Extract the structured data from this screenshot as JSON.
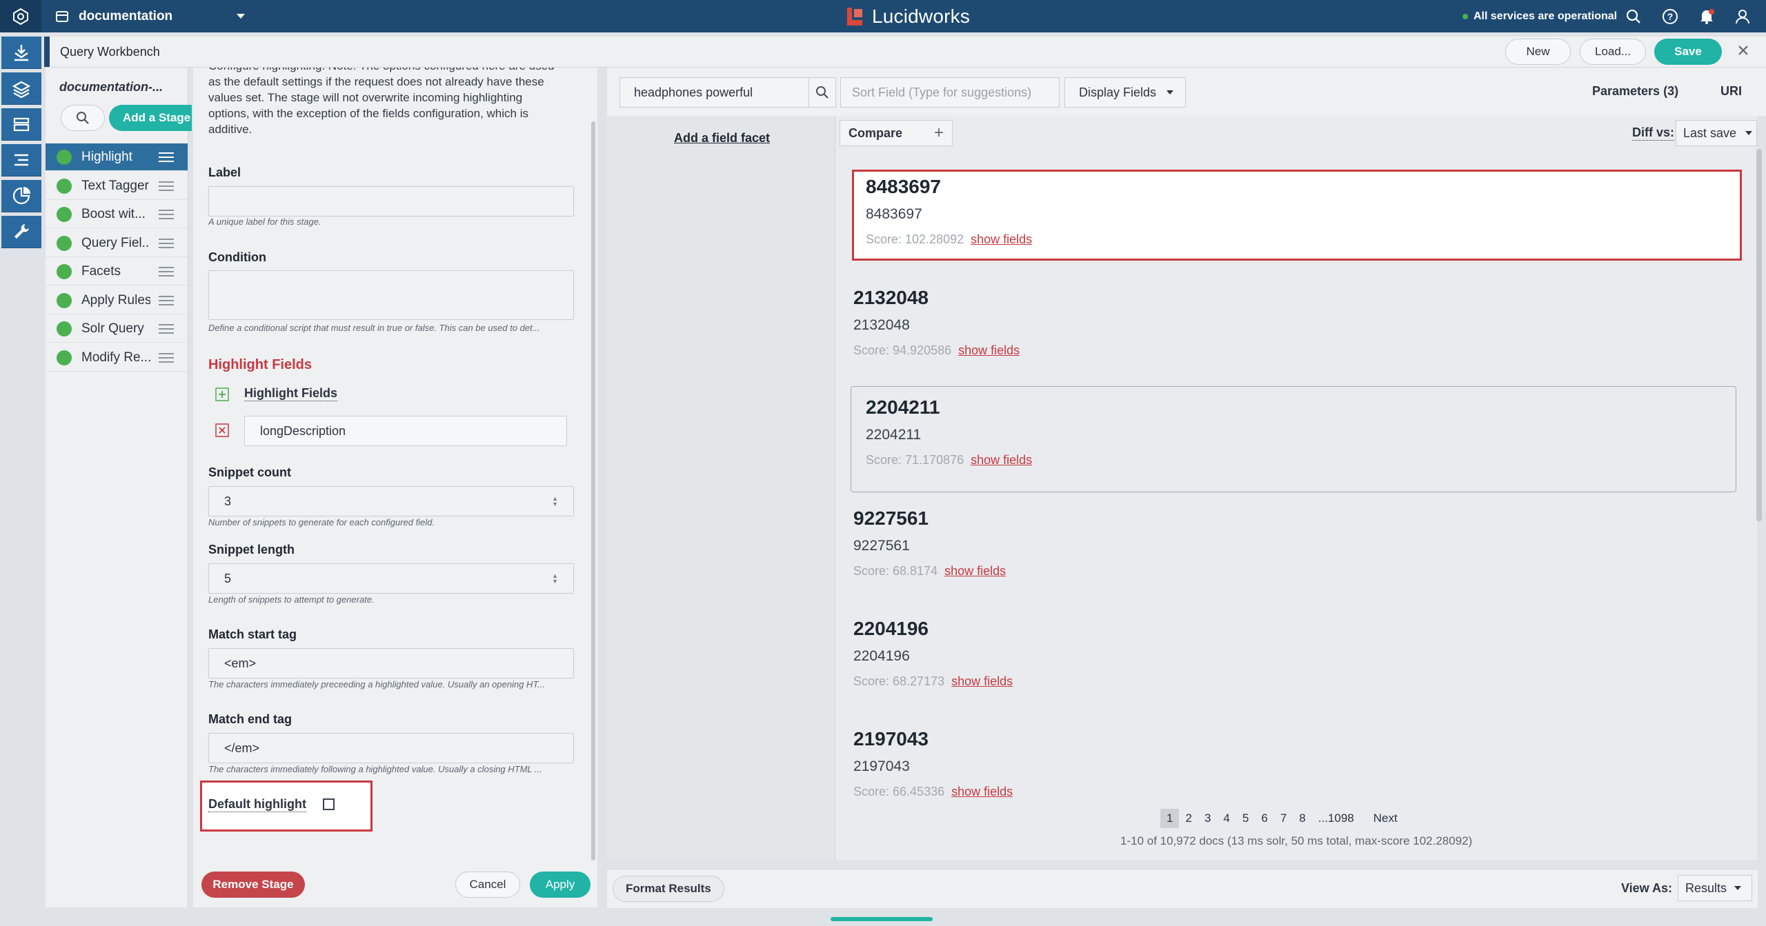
{
  "topbar": {
    "app_name": "documentation",
    "brand": "Lucidworks",
    "status": "All services are operational",
    "icons": [
      "search-icon",
      "help-icon",
      "notification-bell-icon",
      "user-icon"
    ]
  },
  "workbench": {
    "title": "Query Workbench",
    "new_label": "New",
    "load_label": "Load...",
    "save_label": "Save"
  },
  "stages": {
    "pipeline_name": "documentation-...",
    "add_stage_label": "Add a Stage",
    "items": [
      {
        "label": "Highlight"
      },
      {
        "label": "Text Tagger"
      },
      {
        "label": "Boost wit..."
      },
      {
        "label": "Query Fiel..."
      },
      {
        "label": "Facets"
      },
      {
        "label": "Apply Rules"
      },
      {
        "label": "Solr Query"
      },
      {
        "label": "Modify Re..."
      }
    ]
  },
  "config": {
    "intro": "Configure highlighting. Note: The options configured here are used as the default settings if the request does not already have these values set. The stage will not overwrite incoming highlighting options, with the exception of the fields configuration, which is additive.",
    "label": {
      "title": "Label",
      "value": "",
      "help": "A unique label for this stage."
    },
    "condition": {
      "title": "Condition",
      "value": "",
      "help": "Define a conditional script that must result in true or false. This can be used to det..."
    },
    "highlight_fields_section": "Highlight Fields",
    "highlight_fields_add": "Highlight Fields",
    "highlight_field_value": "longDescription",
    "snippet_count": {
      "title": "Snippet count",
      "value": "3",
      "help": "Number of snippets to generate for each configured field."
    },
    "snippet_length": {
      "title": "Snippet length",
      "value": "5",
      "help": "Length of snippets to attempt to generate."
    },
    "match_start": {
      "title": "Match start tag",
      "value": "<em>",
      "help": "The characters immediately preceeding a highlighted value. Usually an opening HT..."
    },
    "match_end": {
      "title": "Match end tag",
      "value": "</em>",
      "help": "The characters immediately following a highlighted value. Usually a closing HTML ..."
    },
    "default_highlight": {
      "title": "Default highlight",
      "checked": false
    },
    "remove_label": "Remove Stage",
    "cancel_label": "Cancel",
    "apply_label": "Apply"
  },
  "query": {
    "value": "headphones powerful",
    "sort_placeholder": "Sort Field (Type for suggestions)",
    "display_fields_label": "Display Fields",
    "parameters_label": "Parameters (3)",
    "uri_label": "URI"
  },
  "facets": {
    "add_label": "Add a field facet"
  },
  "results": {
    "compare_label": "Compare",
    "diff_label": "Diff vs:",
    "diff_value": "Last save",
    "docs": [
      {
        "id": "8483697",
        "sub": "8483697",
        "score": "Score: 102.28092",
        "link": "show fields"
      },
      {
        "id": "2132048",
        "sub": "2132048",
        "score": "Score: 94.920586",
        "link": "show fields"
      },
      {
        "id": "2204211",
        "sub": "2204211",
        "score": "Score: 71.170876",
        "link": "show fields"
      },
      {
        "id": "9227561",
        "sub": "9227561",
        "score": "Score: 68.8174",
        "link": "show fields"
      },
      {
        "id": "2204196",
        "sub": "2204196",
        "score": "Score: 68.27173",
        "link": "show fields"
      },
      {
        "id": "2197043",
        "sub": "2197043",
        "score": "Score: 66.45336",
        "link": "show fields"
      }
    ],
    "pages": [
      "1",
      "2",
      "3",
      "4",
      "5",
      "6",
      "7",
      "8",
      "...1098",
      "Next"
    ],
    "current_page": "1",
    "meta": "1-10 of 10,972 docs (13 ms solr, 50 ms total, max-score 102.28092)"
  },
  "footer": {
    "format_label": "Format Results",
    "view_as_label": "View As:",
    "view_as_value": "Results"
  },
  "colors": {
    "topbar": "#1e4a72",
    "accent_teal": "#20b3a6",
    "danger_red": "#c8393f",
    "active_stage": "#2e6e9e",
    "ok_green": "#4caf50"
  }
}
